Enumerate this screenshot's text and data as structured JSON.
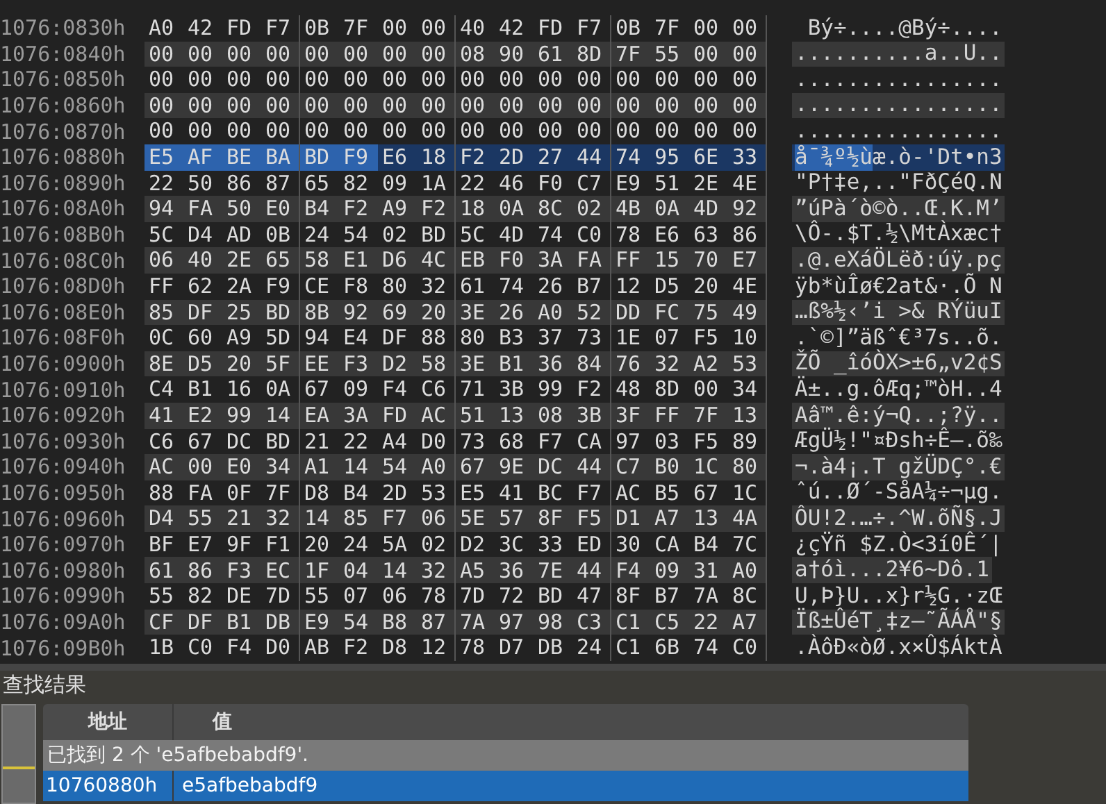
{
  "hex_view": {
    "rows": [
      {
        "address": "1076:0830h",
        "selected": false,
        "bytes": [
          "A0",
          "42",
          "FD",
          "F7",
          "0B",
          "7F",
          "00",
          "00",
          "40",
          "42",
          "FD",
          "F7",
          "0B",
          "7F",
          "00",
          "00"
        ],
        "ascii": " Bý÷....@Bý÷...."
      },
      {
        "address": "1076:0840h",
        "selected": false,
        "bytes": [
          "00",
          "00",
          "00",
          "00",
          "00",
          "00",
          "00",
          "00",
          "08",
          "90",
          "61",
          "8D",
          "7F",
          "55",
          "00",
          "00"
        ],
        "ascii": "..........a..U.."
      },
      {
        "address": "1076:0850h",
        "selected": false,
        "bytes": [
          "00",
          "00",
          "00",
          "00",
          "00",
          "00",
          "00",
          "00",
          "00",
          "00",
          "00",
          "00",
          "00",
          "00",
          "00",
          "00"
        ],
        "ascii": "................"
      },
      {
        "address": "1076:0860h",
        "selected": false,
        "bytes": [
          "00",
          "00",
          "00",
          "00",
          "00",
          "00",
          "00",
          "00",
          "00",
          "00",
          "00",
          "00",
          "00",
          "00",
          "00",
          "00"
        ],
        "ascii": "................"
      },
      {
        "address": "1076:0870h",
        "selected": false,
        "bytes": [
          "00",
          "00",
          "00",
          "00",
          "00",
          "00",
          "00",
          "00",
          "00",
          "00",
          "00",
          "00",
          "00",
          "00",
          "00",
          "00"
        ],
        "ascii": "................"
      },
      {
        "address": "1076:0880h",
        "selected": true,
        "match_bytes": [
          "E5",
          "AF",
          "BE",
          "BA",
          "BD",
          "F9"
        ],
        "bytes": [
          "E6",
          "18",
          "F2",
          "2D",
          "27",
          "44",
          "74",
          "95",
          "6E",
          "33"
        ],
        "ascii_match": "å¯¾º½ù",
        "ascii": "æ.ò-'Dt•n3"
      },
      {
        "address": "1076:0890h",
        "selected": false,
        "bytes": [
          "22",
          "50",
          "86",
          "87",
          "65",
          "82",
          "09",
          "1A",
          "22",
          "46",
          "F0",
          "C7",
          "E9",
          "51",
          "2E",
          "4E"
        ],
        "ascii": "\"P†‡e,..\"FðÇéQ.N"
      },
      {
        "address": "1076:08A0h",
        "selected": false,
        "bytes": [
          "94",
          "FA",
          "50",
          "E0",
          "B4",
          "F2",
          "A9",
          "F2",
          "18",
          "0A",
          "8C",
          "02",
          "4B",
          "0A",
          "4D",
          "92"
        ],
        "ascii": "”úPà´ò©ò..Œ.K.M’"
      },
      {
        "address": "1076:08B0h",
        "selected": false,
        "bytes": [
          "5C",
          "D4",
          "AD",
          "0B",
          "24",
          "54",
          "02",
          "BD",
          "5C",
          "4D",
          "74",
          "C0",
          "78",
          "E6",
          "63",
          "86"
        ],
        "ascii": "\\Ô-.$T.½\\MtÀxæc†"
      },
      {
        "address": "1076:08C0h",
        "selected": false,
        "bytes": [
          "06",
          "40",
          "2E",
          "65",
          "58",
          "E1",
          "D6",
          "4C",
          "EB",
          "F0",
          "3A",
          "FA",
          "FF",
          "15",
          "70",
          "E7"
        ],
        "ascii": ".@.eXáÖLëð:úÿ.pç"
      },
      {
        "address": "1076:08D0h",
        "selected": false,
        "bytes": [
          "FF",
          "62",
          "2A",
          "F9",
          "CE",
          "F8",
          "80",
          "32",
          "61",
          "74",
          "26",
          "B7",
          "12",
          "D5",
          "20",
          "4E"
        ],
        "ascii": "ÿb*ùÎø€2at&·.Õ N"
      },
      {
        "address": "1076:08E0h",
        "selected": false,
        "bytes": [
          "85",
          "DF",
          "25",
          "BD",
          "8B",
          "92",
          "69",
          "20",
          "3E",
          "26",
          "A0",
          "52",
          "DD",
          "FC",
          "75",
          "49"
        ],
        "ascii": "…ß%½‹’i >& RÝüuI"
      },
      {
        "address": "1076:08F0h",
        "selected": false,
        "bytes": [
          "0C",
          "60",
          "A9",
          "5D",
          "94",
          "E4",
          "DF",
          "88",
          "80",
          "B3",
          "37",
          "73",
          "1E",
          "07",
          "F5",
          "10"
        ],
        "ascii": ".`©]”äßˆ€³7s..õ."
      },
      {
        "address": "1076:0900h",
        "selected": false,
        "bytes": [
          "8E",
          "D5",
          "20",
          "5F",
          "EE",
          "F3",
          "D2",
          "58",
          "3E",
          "B1",
          "36",
          "84",
          "76",
          "32",
          "A2",
          "53"
        ],
        "ascii": "ŽÕ _îóÒX>±6„v2¢S"
      },
      {
        "address": "1076:0910h",
        "selected": false,
        "bytes": [
          "C4",
          "B1",
          "16",
          "0A",
          "67",
          "09",
          "F4",
          "C6",
          "71",
          "3B",
          "99",
          "F2",
          "48",
          "8D",
          "00",
          "34"
        ],
        "ascii": "Ä±..g.ôÆq;™òH..4"
      },
      {
        "address": "1076:0920h",
        "selected": false,
        "bytes": [
          "41",
          "E2",
          "99",
          "14",
          "EA",
          "3A",
          "FD",
          "AC",
          "51",
          "13",
          "08",
          "3B",
          "3F",
          "FF",
          "7F",
          "13"
        ],
        "ascii": "Aâ™.ê:ý¬Q..;?ÿ.."
      },
      {
        "address": "1076:0930h",
        "selected": false,
        "bytes": [
          "C6",
          "67",
          "DC",
          "BD",
          "21",
          "22",
          "A4",
          "D0",
          "73",
          "68",
          "F7",
          "CA",
          "97",
          "03",
          "F5",
          "89"
        ],
        "ascii": "ÆgÜ½!\"¤Ðsh÷Ê—.õ‰"
      },
      {
        "address": "1076:0940h",
        "selected": false,
        "bytes": [
          "AC",
          "00",
          "E0",
          "34",
          "A1",
          "14",
          "54",
          "A0",
          "67",
          "9E",
          "DC",
          "44",
          "C7",
          "B0",
          "1C",
          "80"
        ],
        "ascii": "¬.à4¡.T gžÜDÇ°.€"
      },
      {
        "address": "1076:0950h",
        "selected": false,
        "bytes": [
          "88",
          "FA",
          "0F",
          "7F",
          "D8",
          "B4",
          "2D",
          "53",
          "E5",
          "41",
          "BC",
          "F7",
          "AC",
          "B5",
          "67",
          "1C"
        ],
        "ascii": "ˆú..Ø´-SåA¼÷¬µg."
      },
      {
        "address": "1076:0960h",
        "selected": false,
        "bytes": [
          "D4",
          "55",
          "21",
          "32",
          "14",
          "85",
          "F7",
          "06",
          "5E",
          "57",
          "8F",
          "F5",
          "D1",
          "A7",
          "13",
          "4A"
        ],
        "ascii": "ÔU!2.…÷.^W.õÑ§.J"
      },
      {
        "address": "1076:0970h",
        "selected": false,
        "bytes": [
          "BF",
          "E7",
          "9F",
          "F1",
          "20",
          "24",
          "5A",
          "02",
          "D2",
          "3C",
          "33",
          "ED",
          "30",
          "CA",
          "B4",
          "7C"
        ],
        "ascii": "¿çŸñ $Z.Ò<3í0Ê´|"
      },
      {
        "address": "1076:0980h",
        "selected": false,
        "bytes": [
          "61",
          "86",
          "F3",
          "EC",
          "1F",
          "04",
          "14",
          "32",
          "A5",
          "36",
          "7E",
          "44",
          "F4",
          "09",
          "31",
          "A0"
        ],
        "ascii": "a†óì...2¥6~Dô.1"
      },
      {
        "address": "1076:0990h",
        "selected": false,
        "bytes": [
          "55",
          "82",
          "DE",
          "7D",
          "55",
          "07",
          "06",
          "78",
          "7D",
          "72",
          "BD",
          "47",
          "8F",
          "B7",
          "7A",
          "8C"
        ],
        "ascii": "U‚Þ}U..x}r½G.·zŒ"
      },
      {
        "address": "1076:09A0h",
        "selected": false,
        "bytes": [
          "CF",
          "DF",
          "B1",
          "DB",
          "E9",
          "54",
          "B8",
          "87",
          "7A",
          "97",
          "98",
          "C3",
          "C1",
          "C5",
          "22",
          "A7"
        ],
        "ascii": "Ïß±ÛéT¸‡z—˜ÃÁÅ\"§"
      },
      {
        "address": "1076:09B0h",
        "selected": false,
        "bytes": [
          "1B",
          "C0",
          "F4",
          "D0",
          "AB",
          "F2",
          "D8",
          "12",
          "78",
          "D7",
          "DB",
          "24",
          "C1",
          "6B",
          "74",
          "C0"
        ],
        "ascii": ".ÀôÐ«òØ.x×Û$ÁktÀ"
      }
    ]
  },
  "find_results": {
    "title": "查找结果",
    "columns": [
      "地址",
      "值"
    ],
    "message": "已找到 2 个 'e5afbebabdf9'.",
    "results": [
      {
        "address": "10760880h",
        "value": "e5afbebabdf9",
        "selected": true
      }
    ]
  }
}
